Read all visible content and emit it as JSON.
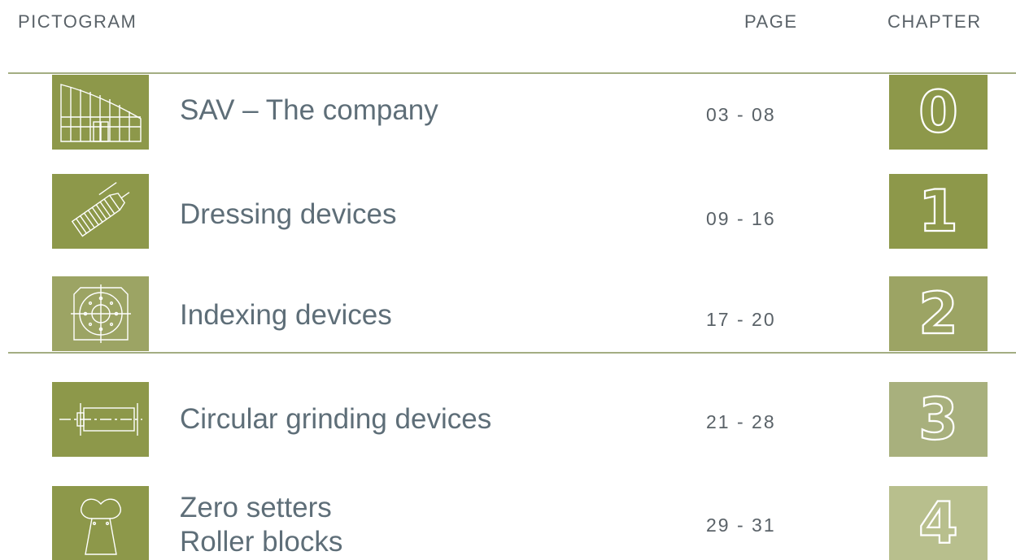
{
  "header": {
    "pictogram": "PICTOGRAM",
    "page": "PAGE",
    "chapter": "CHAPTER"
  },
  "rows": [
    {
      "icon": "building-icon",
      "title": "SAV – The company",
      "pages": "03 - 08",
      "chapter": "0",
      "color": "#8d984a"
    },
    {
      "icon": "dressing-tool-icon",
      "title": "Dressing devices",
      "pages": "09 - 16",
      "chapter": "1",
      "color": "#8d984a"
    },
    {
      "icon": "indexing-table-icon",
      "title": "Indexing devices",
      "pages": "17 - 20",
      "chapter": "2",
      "color": "#9ca464"
    },
    {
      "icon": "cylinder-icon",
      "title": "Circular grinding devices",
      "pages": "21 - 28",
      "chapter": "3",
      "color": "#a8b07d"
    },
    {
      "icon": "zero-setter-icon",
      "title": "Zero setters",
      "title_line2": "Roller blocks",
      "pages": "29 - 31",
      "chapter": "4",
      "color": "#b8bf8d"
    }
  ],
  "colors": {
    "olive": "#8d984a",
    "text": "#5e6e78",
    "rule": "#a3ad82"
  }
}
